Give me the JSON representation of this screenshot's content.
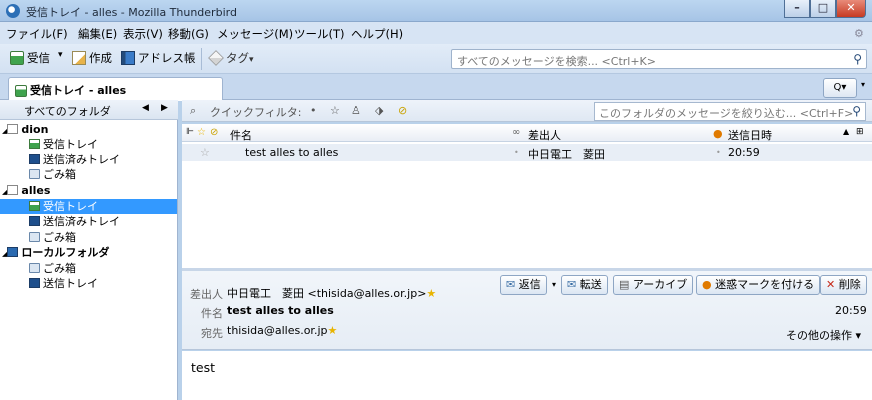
{
  "window": {
    "title": "受信トレイ - alles - Mozilla Thunderbird",
    "min_label": "–",
    "max_label": "□",
    "close_label": "✕"
  },
  "menu": [
    "ファイル(F)",
    "編集(E)",
    "表示(V)",
    "移動(G)",
    "メッセージ(M)",
    "ツール(T)",
    "ヘルプ(H)"
  ],
  "toolbar": {
    "get_label": "受信",
    "get_dropdown": "▾",
    "write_label": "作成",
    "addressbook_label": "アドレス帳",
    "tag_label": "タグ",
    "tag_dropdown": "▾",
    "search_placeholder": "すべてのメッセージを検索... <Ctrl+K>",
    "search_icon": "search-icon"
  },
  "tab": {
    "label": "受信トレイ - alles",
    "search_btn": "Q▾",
    "more": "▾"
  },
  "folderpane": {
    "header": "すべてのフォルダ",
    "prev": "◀",
    "next": "▶",
    "tree": [
      {
        "label": "dion",
        "type": "account",
        "expander": "◢",
        "selected": false
      },
      {
        "label": "受信トレイ",
        "type": "inbox",
        "selected": false
      },
      {
        "label": "送信済みトレイ",
        "type": "sent",
        "selected": false
      },
      {
        "label": "ごみ箱",
        "type": "trash",
        "selected": false
      },
      {
        "label": "alles",
        "type": "account",
        "expander": "◢",
        "selected": false
      },
      {
        "label": "受信トレイ",
        "type": "inbox",
        "selected": true
      },
      {
        "label": "送信済みトレイ",
        "type": "sent",
        "selected": false
      },
      {
        "label": "ごみ箱",
        "type": "trash",
        "selected": false
      },
      {
        "label": "ローカルフォルダ",
        "type": "local",
        "expander": "◢",
        "selected": false
      },
      {
        "label": "ごみ箱",
        "type": "trash",
        "selected": false
      },
      {
        "label": "送信トレイ",
        "type": "outbox",
        "selected": false
      }
    ]
  },
  "quickfilter": {
    "label": "クイックフィルタ:",
    "search_placeholder": "このフォルダのメッセージを絞り込む... <Ctrl+F>"
  },
  "columns": {
    "subject": "件名",
    "sender": "差出人",
    "date": "送信日時"
  },
  "messages": [
    {
      "subject": "test alles to alles",
      "sender": "中日電工　菱田",
      "date": "20:59"
    }
  ],
  "message_header": {
    "from_label": "差出人",
    "from_value": "中日電工　菱田 <thisida@alles.or.jp>",
    "subject_label": "件名",
    "subject_value": "test alles to alles",
    "to_label": "宛先",
    "to_value": "thisida@alles.or.jp",
    "time": "20:59",
    "reply_btn": "返信",
    "forward_btn": "転送",
    "archive_btn": "アーカイブ",
    "junk_btn": "迷惑マークを付ける",
    "delete_btn": "削除",
    "other_actions": "その他の操作 ▾"
  },
  "message_body": "test",
  "colors": {
    "selection": "#3399ff",
    "chrome": "#d7e4f4",
    "close_button": "#c63a22"
  }
}
